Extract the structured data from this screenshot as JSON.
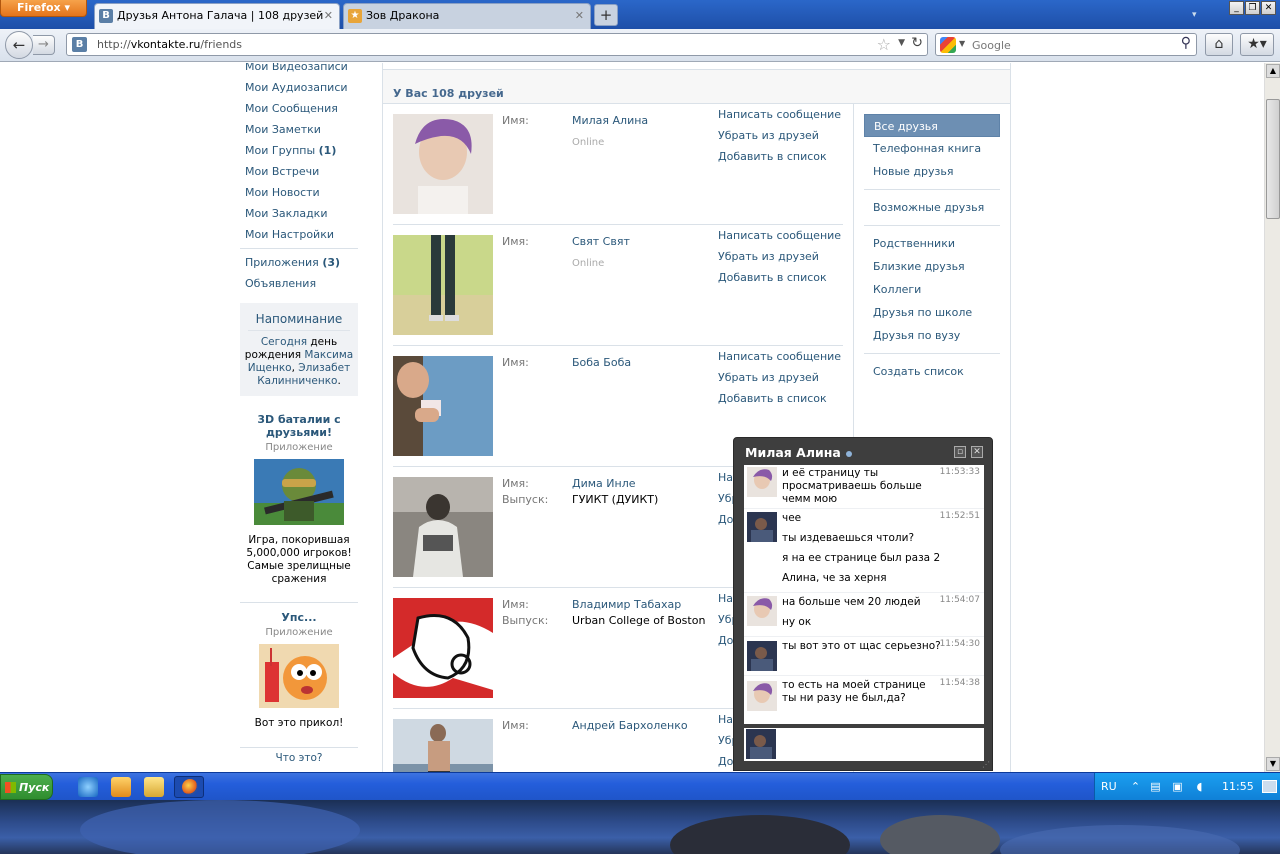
{
  "browser": {
    "menu_button": "Firefox",
    "tabs": [
      {
        "title": "Друзья Антона Галача | 108 друзей",
        "icon": "vk-favicon"
      },
      {
        "title": "Зов Дракона",
        "icon": "game-favicon"
      }
    ],
    "url_prefix": "http://",
    "url_host": "vkontakte.ru",
    "url_path": "/friends",
    "search_placeholder": "Google"
  },
  "left_menu": {
    "items": [
      "Мои Видеозаписи",
      "Мои Аудиозаписи",
      "Мои Сообщения",
      "Мои Заметки",
      "Мои Группы",
      "Мои Встречи",
      "Мои Новости",
      "Мои Закладки",
      "Мои Настройки"
    ],
    "groups_count": "(1)",
    "apps_label": "Приложения",
    "apps_count": "(3)",
    "ads_label": "Объявления"
  },
  "reminder": {
    "title": "Напоминание",
    "today": "Сегодня",
    "text1": " день рождения ",
    "person1": "Максима Ищенко",
    "sep": ", ",
    "person2": "Элизабет Калинниченко",
    "end": "."
  },
  "apps": [
    {
      "title": "3D баталии с друзьями!",
      "subtitle": "Приложение",
      "desc": "Игра, покорившая 5,000,000 игроков! Самые зрелищные сражения"
    },
    {
      "title": "Упс...",
      "subtitle": "Приложение",
      "desc": "Вот это прикол!"
    }
  ],
  "what_is_this": "Что это?",
  "friends_header": "У Вас 108 друзей",
  "labels": {
    "name": "Имя:",
    "grad": "Выпуск:"
  },
  "actions": {
    "message": "Написать сообщение",
    "remove": "Убрать из друзей",
    "add_to_list": "Добавить в список"
  },
  "friends": [
    {
      "name": "Милая Алина",
      "status": "Online",
      "grad": ""
    },
    {
      "name": "Свят Свят",
      "status": "Online",
      "grad": ""
    },
    {
      "name": "Боба Боба",
      "status": "",
      "grad": ""
    },
    {
      "name": "Дима Инле",
      "status": "",
      "grad": "ГУИКТ (ДУИКТ)"
    },
    {
      "name": "Владимир Табахар",
      "status": "",
      "grad": "Urban College of Boston"
    },
    {
      "name": "Андрей Бархоленко",
      "status": "",
      "grad": ""
    }
  ],
  "filters": {
    "group1": [
      "Все друзья",
      "Телефонная книга",
      "Новые друзья"
    ],
    "group2": [
      "Возможные друзья"
    ],
    "group3": [
      "Родственники",
      "Близкие друзья",
      "Коллеги",
      "Друзья по школе",
      "Друзья по вузу"
    ],
    "group4": [
      "Создать список"
    ],
    "selected": "Все друзья"
  },
  "chat": {
    "title": "Милая Алина",
    "messages": [
      {
        "from": "alina",
        "time": "11:53:33",
        "lines": [
          "и её страницу ты просматриваешь больше чемм мою"
        ]
      },
      {
        "from": "me",
        "time": "11:52:51",
        "lines": [
          "чее",
          "ты издеваешься чтоли?",
          "я на ее странице был раза 2",
          "Алина, че за херня"
        ]
      },
      {
        "from": "alina",
        "time": "11:54:07",
        "lines": [
          "на больше чем 20 людей",
          "ну ок"
        ]
      },
      {
        "from": "me",
        "time": "11:54:30",
        "lines": [
          "ты вот это от щас серьезно?"
        ]
      },
      {
        "from": "alina",
        "time": "11:54:38",
        "lines": [
          "то есть на моей странице ты ни разу не был,да?"
        ]
      }
    ]
  },
  "taskbar": {
    "start": "Пуск",
    "lang": "RU",
    "clock": "11:55"
  },
  "colors": {
    "vk_link": "#2b587a",
    "vk_header": "#45688e",
    "selected_filter": "#6d8fb3",
    "chat_bg": "#3e3e3e",
    "taskbar": "#245edb"
  }
}
